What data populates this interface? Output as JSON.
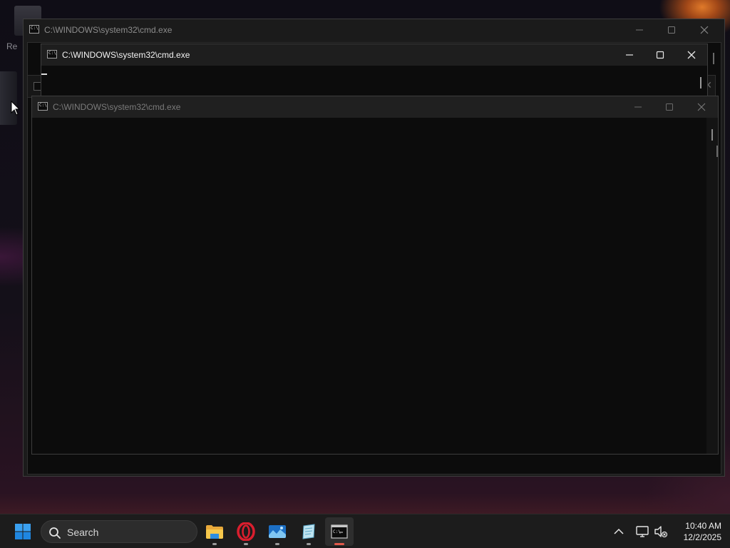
{
  "desktop": {
    "partial_icon_label": "Re"
  },
  "windows": [
    {
      "title": "C:\\WINDOWS\\system32\\cmd.exe",
      "state": "background"
    },
    {
      "title": "C:\\WINDOWS\\system32\\cmd.exe",
      "state": "focused"
    },
    {
      "title": "C:\\WINDOWS\\system32\\cmd.exe",
      "state": "background"
    },
    {
      "title": "C:\\WINDOWS\\system32\\cmd.exe",
      "state": "foreground-inactive"
    }
  ],
  "window_controls": {
    "minimize_icon": "minimize-icon",
    "maximize_icon": "maximize-icon",
    "close_icon": "close-icon"
  },
  "taskbar": {
    "search_placeholder": "Search",
    "apps": [
      {
        "name": "File Explorer",
        "icon": "folder-icon"
      },
      {
        "name": "Opera",
        "icon": "opera-icon"
      },
      {
        "name": "Photos",
        "icon": "photos-icon"
      },
      {
        "name": "Notepad",
        "icon": "notepad-icon"
      },
      {
        "name": "Command Prompt",
        "icon": "cmd-icon",
        "active": true
      }
    ],
    "clock": {
      "time": "10:40 AM",
      "date": "12/2/2025"
    }
  },
  "colors": {
    "accent_windows": "#0078d4",
    "active_indicator": "#e2594b",
    "opera_red": "#d91e2e",
    "folder_yellow": "#f4c542"
  }
}
